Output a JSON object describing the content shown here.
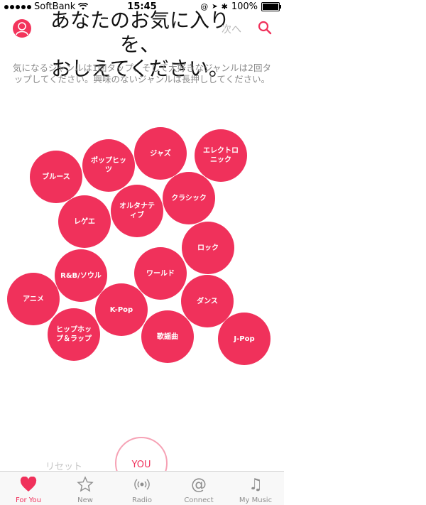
{
  "status_bar": {
    "carrier": "SoftBank",
    "time": "15:45",
    "battery_text": "100%",
    "battery_level": 1.0
  },
  "header": {
    "title_line1": "あなたのお気に入りを、",
    "title_line2": "おしえてください。",
    "next_label": "次へ",
    "instructions": "気になるジャンルは1回タップ、そして大好きなジャンルは2回タップしてください。興味のないジャンルは長押ししてください。"
  },
  "genres": [
    {
      "id": "blues",
      "label": "ブルース"
    },
    {
      "id": "pophits",
      "label": "ポップヒッツ"
    },
    {
      "id": "jazz",
      "label": "ジャズ"
    },
    {
      "id": "electronic",
      "label": "エレクトロニック"
    },
    {
      "id": "reggae",
      "label": "レゲエ"
    },
    {
      "id": "alternative",
      "label": "オルタナティブ"
    },
    {
      "id": "classic",
      "label": "クラシック"
    },
    {
      "id": "rock",
      "label": "ロック"
    },
    {
      "id": "rnb",
      "label": "R&B/ソウル"
    },
    {
      "id": "world",
      "label": "ワールド"
    },
    {
      "id": "anime",
      "label": "アニメ"
    },
    {
      "id": "kpop",
      "label": "K-Pop"
    },
    {
      "id": "dance",
      "label": "ダンス"
    },
    {
      "id": "hiphop",
      "label": "ヒップホップ＆ラップ"
    },
    {
      "id": "kayokyoku",
      "label": "歌謡曲"
    },
    {
      "id": "jpop",
      "label": "J-Pop"
    }
  ],
  "bottom": {
    "reset_label": "リセット",
    "you_label": "YOU"
  },
  "tabs": [
    {
      "label": "For You",
      "icon": "heart-icon",
      "active": true
    },
    {
      "label": "New",
      "icon": "star-icon",
      "active": false
    },
    {
      "label": "Radio",
      "icon": "radio-icon",
      "active": false
    },
    {
      "label": "Connect",
      "icon": "at-icon",
      "active": false
    },
    {
      "label": "My Music",
      "icon": "music-note-icon",
      "active": false
    }
  ],
  "colors": {
    "accent": "#f0315b",
    "inactive_tab": "#8e8e8e"
  }
}
